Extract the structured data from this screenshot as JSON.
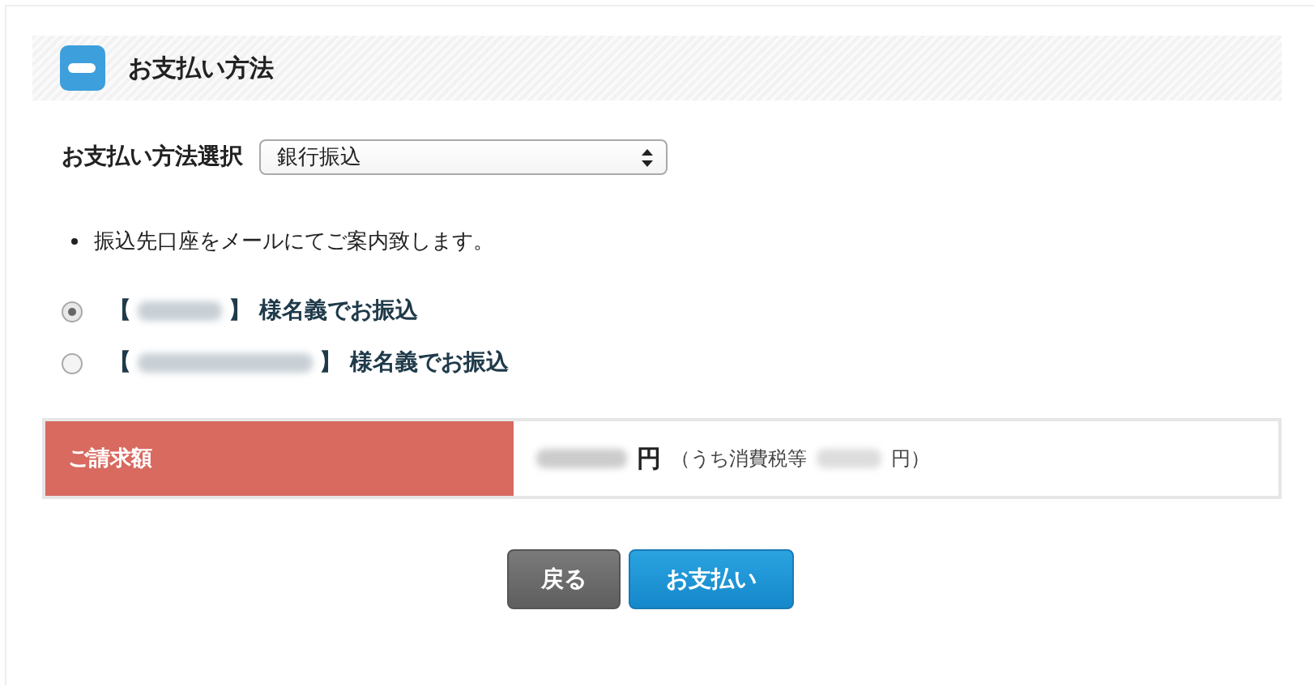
{
  "section": {
    "title": "お支払い方法"
  },
  "method": {
    "label": "お支払い方法選択",
    "value": "銀行振込"
  },
  "notes": [
    "振込先口座をメールにてご案内致します。"
  ],
  "accounts": [
    {
      "open": "【",
      "close": "】 様名義でお振込",
      "selected": true
    },
    {
      "open": "【",
      "close": "】 様名義でお振込",
      "selected": false
    }
  ],
  "amount": {
    "label": "ご請求額",
    "currency": "円",
    "tax_open": "（うち消費税等",
    "tax_close": "円）"
  },
  "buttons": [
    {
      "label": "戻る",
      "kind": "back"
    },
    {
      "label": "お支払い",
      "kind": "primary"
    }
  ]
}
